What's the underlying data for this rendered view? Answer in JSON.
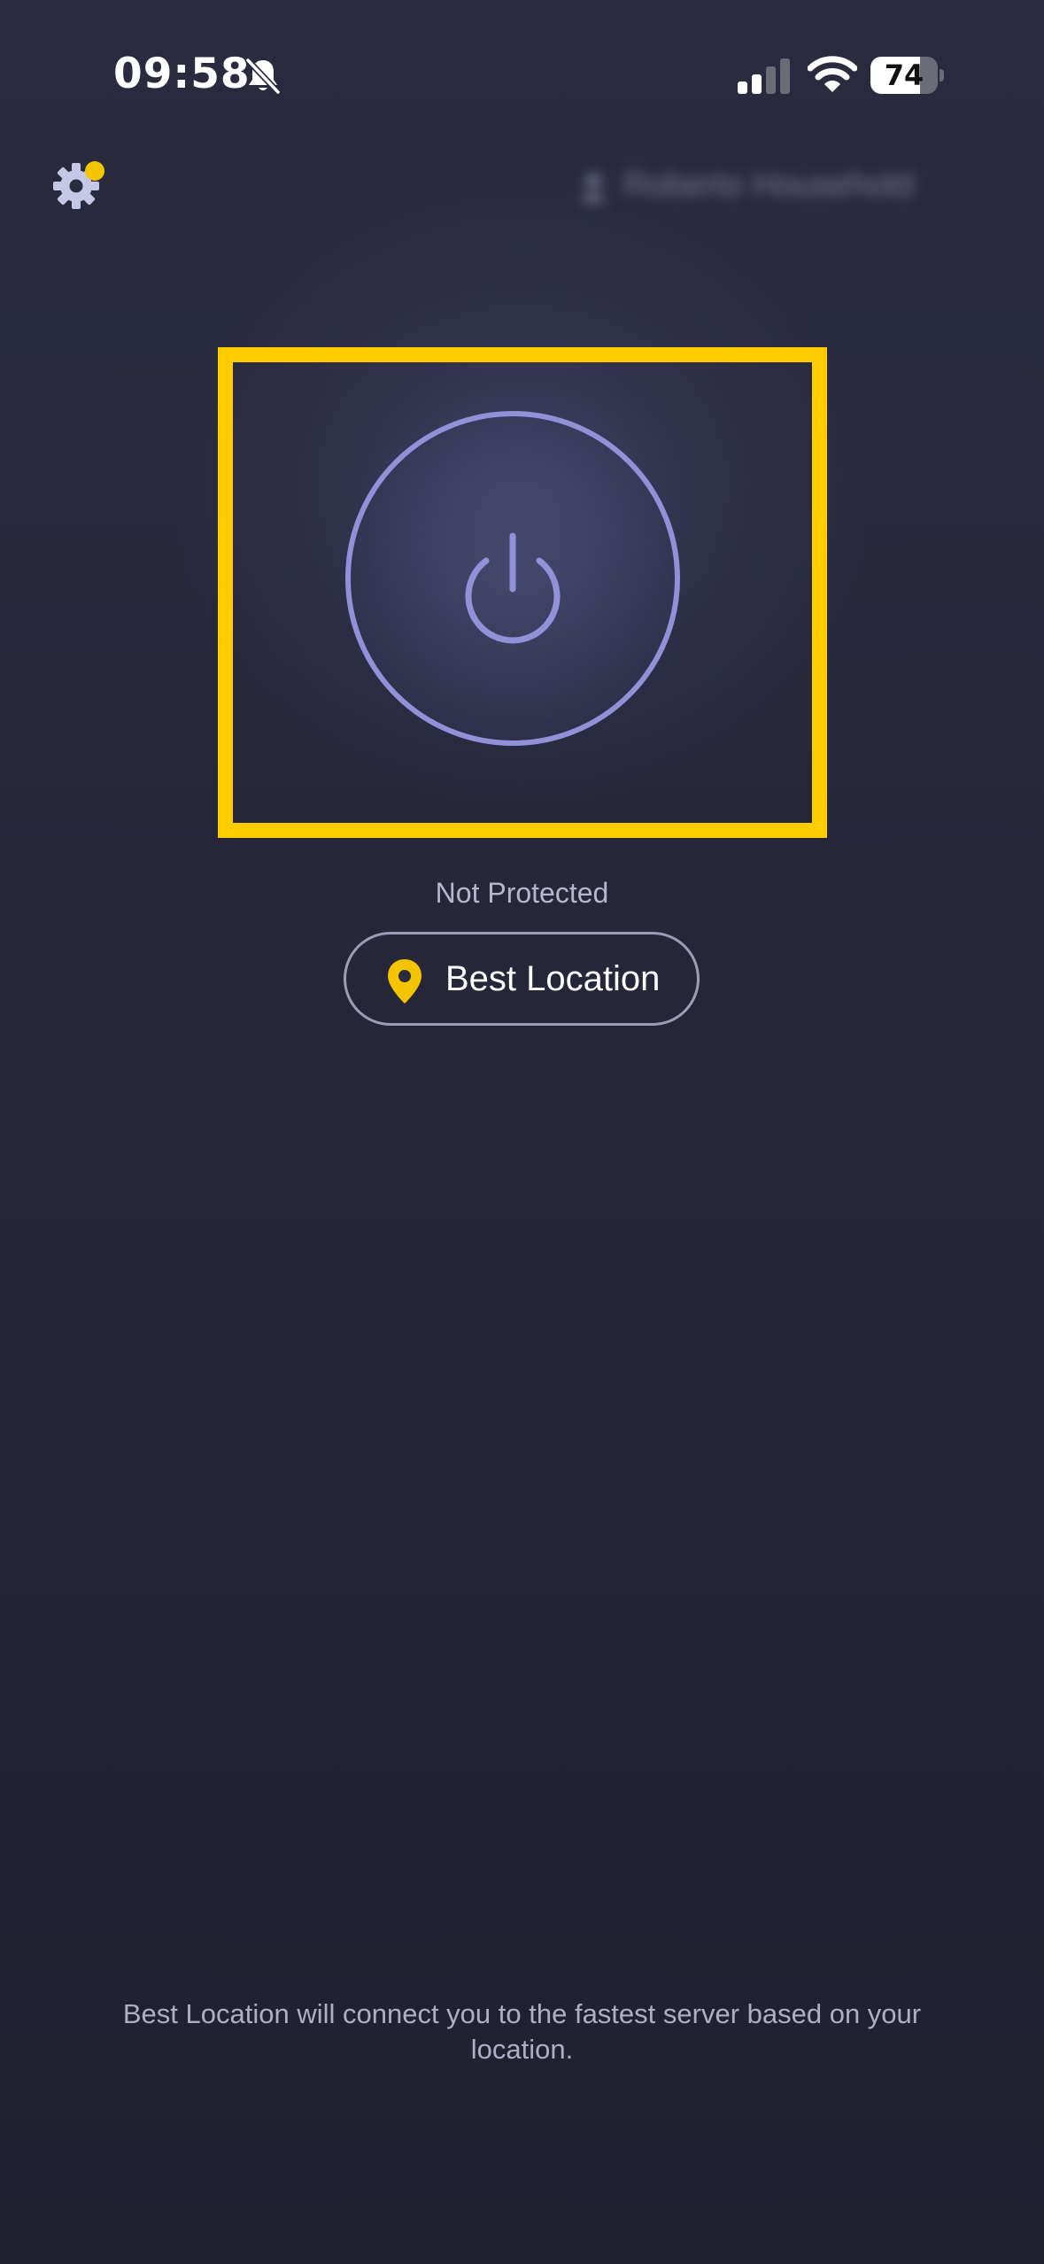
{
  "status_bar": {
    "time": "09:58",
    "battery_level": 74,
    "battery_label": "74",
    "icons": [
      "bell-slash-icon",
      "cellular-signal-icon",
      "wifi-icon",
      "battery-icon"
    ]
  },
  "header": {
    "settings_icon": "gear-icon",
    "settings_has_notification": true,
    "account_label": "Roberto Household",
    "account_label_obscured": true
  },
  "main": {
    "power_icon": "power-icon",
    "status_text": "Not Protected",
    "location_icon": "map-pin-icon",
    "location_label": "Best Location",
    "footer_note": "Best Location will connect you to the fastest server based on your location."
  },
  "colors": {
    "background": "#2a2b3f",
    "accent": "#f5c400",
    "highlight_box": "#ffcc00",
    "power_ring": "#9190d8"
  }
}
